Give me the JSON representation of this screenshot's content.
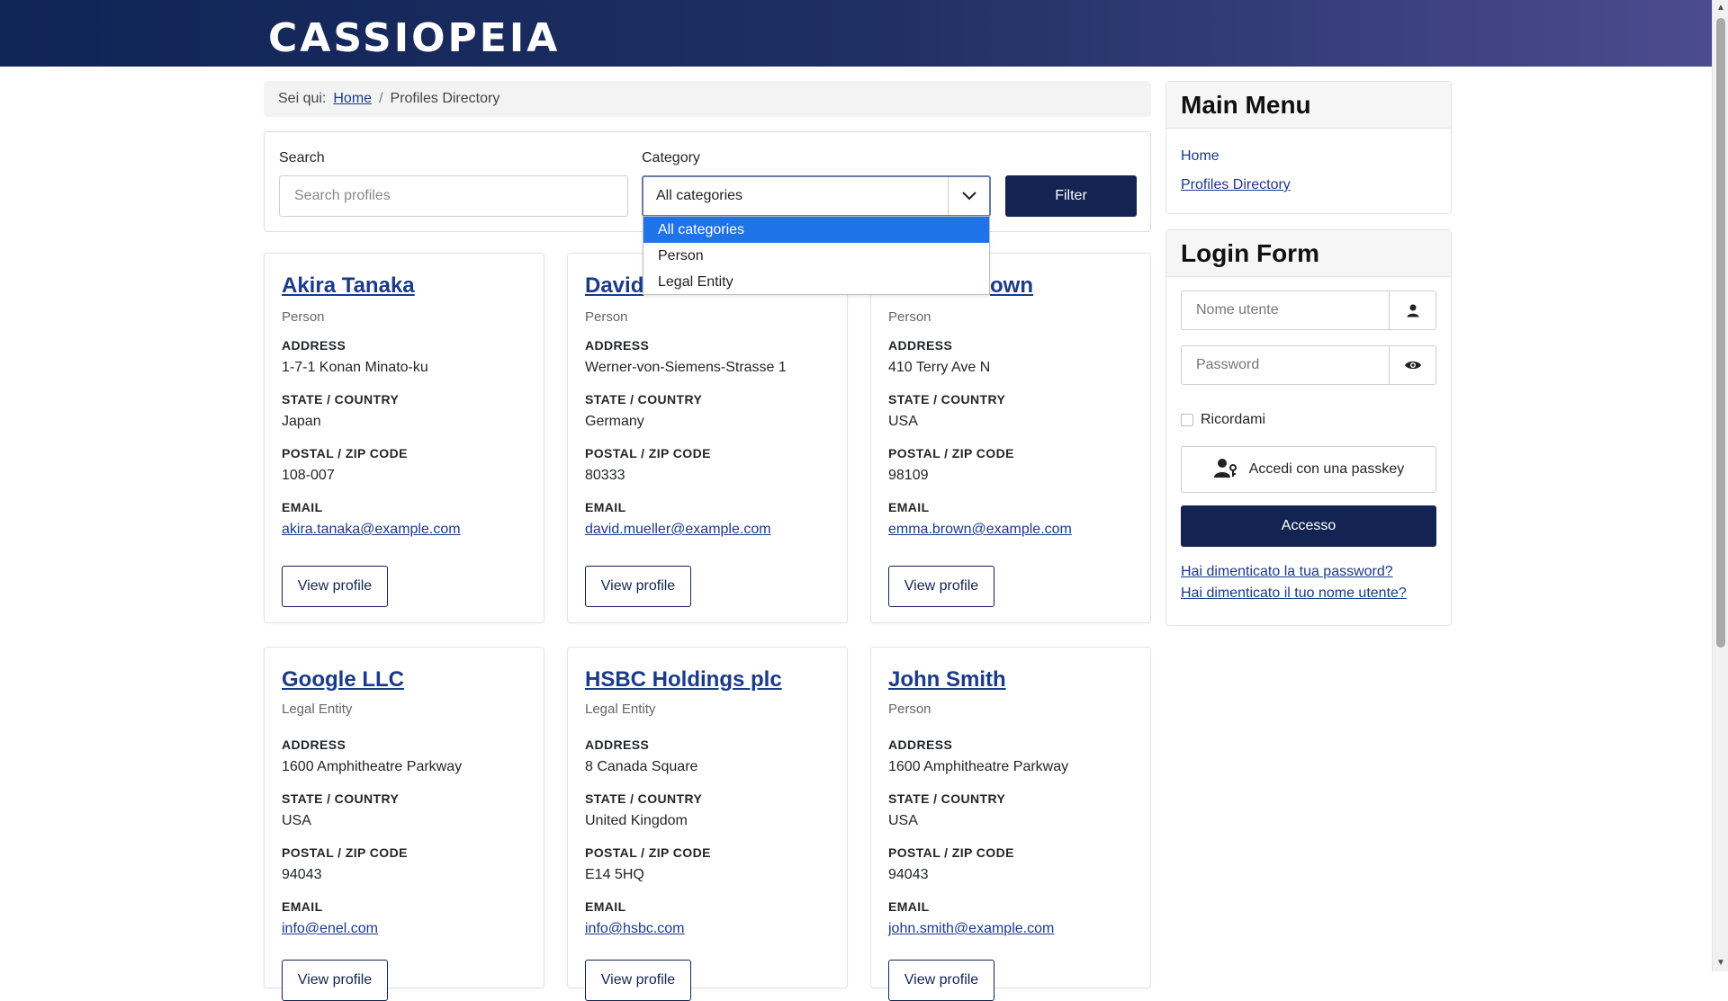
{
  "brand": "CASSIOPEIA",
  "breadcrumb": {
    "prefix": "Sei qui:",
    "home": "Home",
    "separator": "/",
    "current": "Profiles Directory"
  },
  "filters": {
    "search_label": "Search",
    "search_placeholder": "Search profiles",
    "category_label": "Category",
    "category_selected": "All categories",
    "category_options": [
      "All categories",
      "Person",
      "Legal Entity"
    ],
    "filter_button": "Filter"
  },
  "field_labels": {
    "address": "ADDRESS",
    "state": "STATE / COUNTRY",
    "postal": "POSTAL / ZIP CODE",
    "email": "EMAIL"
  },
  "view_profile_label": "View profile",
  "profiles": [
    {
      "name": "Akira Tanaka",
      "type": "Person",
      "address": "1-7-1 Konan Minato-ku",
      "state": "Japan",
      "postal": "108-007",
      "email": "akira.tanaka@example.com"
    },
    {
      "name": "David",
      "type": "Person",
      "address": "Werner-von-Siemens-Strasse 1",
      "state": "Germany",
      "postal": "80333",
      "email": "david.mueller@example.com"
    },
    {
      "name": "own",
      "type": "Person",
      "address": "410 Terry Ave N",
      "state": "USA",
      "postal": "98109",
      "email": "emma.brown@example.com"
    },
    {
      "name": "Google LLC",
      "type": "Legal Entity",
      "address": "1600 Amphitheatre Parkway",
      "state": "USA",
      "postal": "94043",
      "email": "info@enel.com"
    },
    {
      "name": "HSBC Holdings plc",
      "type": "Legal Entity",
      "address": "8 Canada Square",
      "state": "United Kingdom",
      "postal": "E14 5HQ",
      "email": "info@hsbc.com"
    },
    {
      "name": "John Smith",
      "type": "Person",
      "address": "1600 Amphitheatre Parkway",
      "state": "USA",
      "postal": "94043",
      "email": "john.smith@example.com"
    }
  ],
  "main_menu": {
    "title": "Main Menu",
    "items": [
      "Home",
      "Profiles Directory"
    ]
  },
  "login_form": {
    "title": "Login Form",
    "username_placeholder": "Nome utente",
    "password_placeholder": "Password",
    "remember_label": "Ricordami",
    "passkey_label": "Accedi con una passkey",
    "login_button": "Accesso",
    "forgot_password": "Hai dimenticato la tua password?",
    "forgot_username": "Hai dimenticato il tuo nome utente?"
  },
  "icons": {
    "username": "user-icon",
    "password": "eye-icon",
    "passkey": "passkey-user-icon",
    "select": "chevron-down-icon"
  },
  "colors": {
    "header_start": "#112456",
    "header_end": "#4c4b8f",
    "primary_button": "#132452",
    "link": "#1a3a8a",
    "dropdown_active": "#1e73e8"
  }
}
